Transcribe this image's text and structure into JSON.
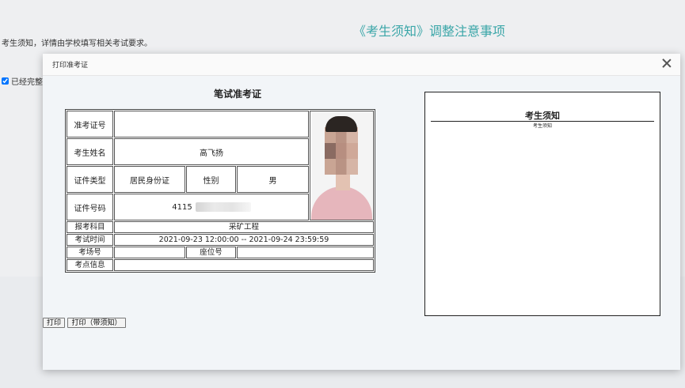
{
  "background": {
    "title": "《考生须知》调整注意事项",
    "notice_text": "考生须知，详情由学校填写相关考试要求。",
    "checkbox_label": "已经完整"
  },
  "dialog": {
    "title": "打印准考证",
    "card_title": "笔试准考证",
    "rows": {
      "ticket_no": {
        "label": "准考证号",
        "value": ""
      },
      "name": {
        "label": "考生姓名",
        "value": "高飞扬"
      },
      "id_type": {
        "label": "证件类型",
        "value": "居民身份证",
        "gender_label": "性别",
        "gender_value": "男"
      },
      "id_no": {
        "label": "证件号码",
        "value": "4115"
      },
      "subject": {
        "label": "报考科目",
        "value": "采矿工程"
      },
      "exam_time": {
        "label": "考试时间",
        "value": "2021-09-23 12:00:00 -- 2021-09-24 23:59:59"
      },
      "room": {
        "label": "考场号",
        "value": "",
        "seat_label": "座位号",
        "seat_value": ""
      },
      "site": {
        "label": "考点信息",
        "value": ""
      }
    },
    "notice": {
      "title": "考生须知",
      "subtitle": "考生须知"
    },
    "buttons": {
      "print": "打印",
      "print_with_notice": "打印（带须知）"
    }
  }
}
